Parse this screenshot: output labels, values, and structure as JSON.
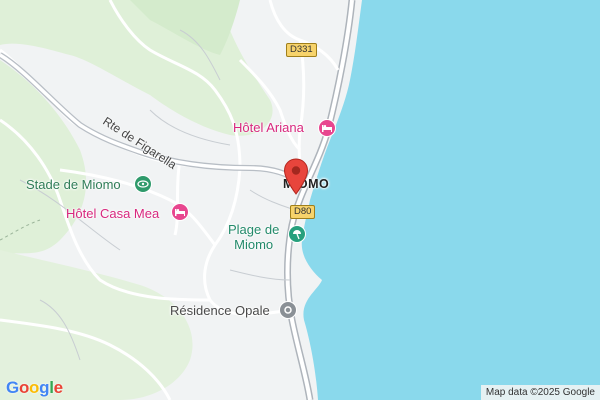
{
  "map": {
    "water_color": "#8ad9ec",
    "land_color": "#f1f3f4",
    "green_color": "#dff0d8",
    "road_color": "#ffffff",
    "highway_color": "#aeb4bb"
  },
  "labels": {
    "hotel_ariana": "Hôtel Ariana",
    "stade": "Stade de Miomo",
    "hotel_casa_mea": "Hôtel Casa Mea",
    "plage_line1": "Plage de",
    "plage_line2": "Miomo",
    "residence": "Résidence Opale",
    "town": "MIOMO",
    "road_figarella": "Rte de Figarella"
  },
  "shields": {
    "d331": "D331",
    "d80": "D80"
  },
  "icons": {
    "hotel": "hotel-bed-icon",
    "stadium": "stadium-icon",
    "beach": "beach-umbrella-icon",
    "residence": "residence-icon",
    "pin": "location-pin-icon"
  },
  "footer": {
    "logo": "Google",
    "attribution": "Map data ©2025 Google"
  }
}
